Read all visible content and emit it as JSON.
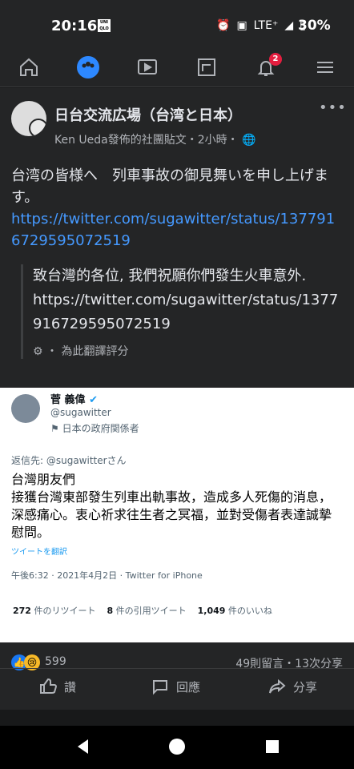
{
  "statusbar": {
    "time": "20:16",
    "uniqlo": "UNI QLO",
    "signal": "LTE⁺",
    "battery": "30%"
  },
  "nav": {
    "notification_badge": "2"
  },
  "post": {
    "group_title": "日台交流広場（台湾と日本）",
    "subline": "Ken Ueda發佈的社團貼文・2小時・",
    "text_line1": "台湾の皆様へ　列車事故の御見舞いを申し上げます。",
    "link_url": "https://twitter.com/sugawitter/status/1377916729595072519",
    "translation": "致台灣的各位, 我們祝願你們發生火車意外.",
    "translation_link": "https://twitter.com/sugawitter/status/1377916729595072519",
    "translation_meta": "・ 為此翻譯評分"
  },
  "tweet": {
    "name": "菅 義偉",
    "handle": "@sugawitter",
    "role": "日本の政府関係者",
    "reply_to": "返信先: @sugawitterさん",
    "text": "台灣朋友們\n接獲台灣東部發生列車出軌事故，造成多人死傷的消息，深感痛心。衷心祈求往生者之冥福，並對受傷者表達誠摯慰問。",
    "translate": "ツイートを翻訳",
    "timestamp": "午後6:32 · 2021年4月2日 · Twitter for iPhone",
    "retweets": "272",
    "retweets_label": "件のリツイート",
    "quotes": "8",
    "quotes_label": "件の引用ツイート",
    "likes": "1,049",
    "likes_label": "件のいいね"
  },
  "reactions": {
    "count": "599",
    "comments_shares": "49則留言・13次分享"
  },
  "actions": {
    "like": "讚",
    "comment": "回應",
    "share": "分享"
  }
}
